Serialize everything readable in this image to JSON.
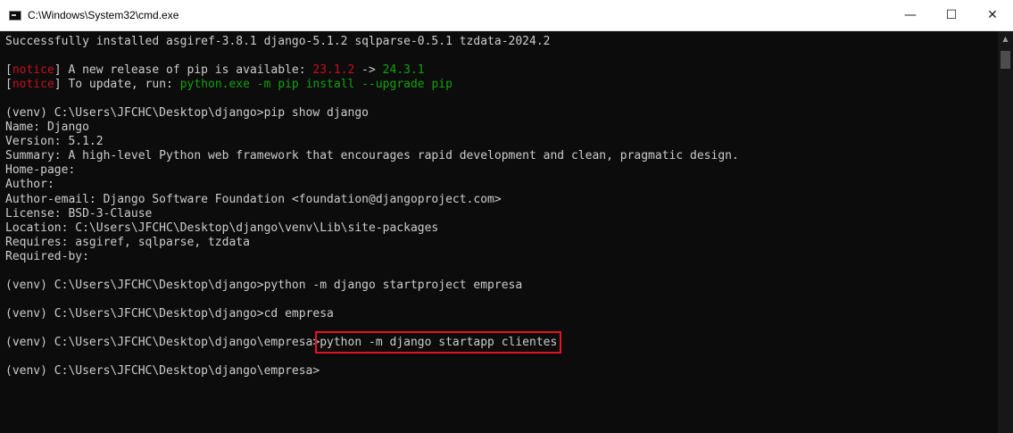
{
  "window": {
    "title": "C:\\Windows\\System32\\cmd.exe",
    "controls": {
      "minimize": "—",
      "maximize": "☐",
      "close": "✕"
    }
  },
  "terminal": {
    "colors": {
      "background": "#0c0c0c",
      "text": "#cccccc",
      "red": "#c50f1f",
      "green": "#13a10e",
      "notice": "#c50f1f",
      "highlight": "#e81123"
    },
    "lines": {
      "l1": "Successfully installed asgiref-3.8.1 django-5.1.2 sqlparse-0.5.1 tzdata-2024.2",
      "notice_open": "[",
      "notice_word": "notice",
      "notice_close": "]",
      "l3_text": " A new release of pip is available: ",
      "l3_old": "23.1.2",
      "l3_arrow": " -> ",
      "l3_new": "24.3.1",
      "l4_text": " To update, run: ",
      "l4_cmd": "python.exe -m pip install --upgrade pip",
      "l6": "(venv) C:\\Users\\JFCHC\\Desktop\\django>pip show django",
      "l7": "Name: Django",
      "l8": "Version: 5.1.2",
      "l9": "Summary: A high-level Python web framework that encourages rapid development and clean, pragmatic design.",
      "l10": "Home-page:",
      "l11": "Author:",
      "l12": "Author-email: Django Software Foundation <foundation@djangoproject.com>",
      "l13": "License: BSD-3-Clause",
      "l14": "Location: C:\\Users\\JFCHC\\Desktop\\django\\venv\\Lib\\site-packages",
      "l15": "Requires: asgiref, sqlparse, tzdata",
      "l16": "Required-by:",
      "l18": "(venv) C:\\Users\\JFCHC\\Desktop\\django>python -m django startproject empresa",
      "l20": "(venv) C:\\Users\\JFCHC\\Desktop\\django>cd empresa",
      "l22_prompt": "(venv) C:\\Users\\JFCHC\\Desktop\\django\\empresa>",
      "l22_cmd": "python -m django startapp clientes",
      "l24": "(venv) C:\\Users\\JFCHC\\Desktop\\django\\empresa>"
    }
  },
  "scrollbar": {
    "up_arrow": "▲"
  }
}
